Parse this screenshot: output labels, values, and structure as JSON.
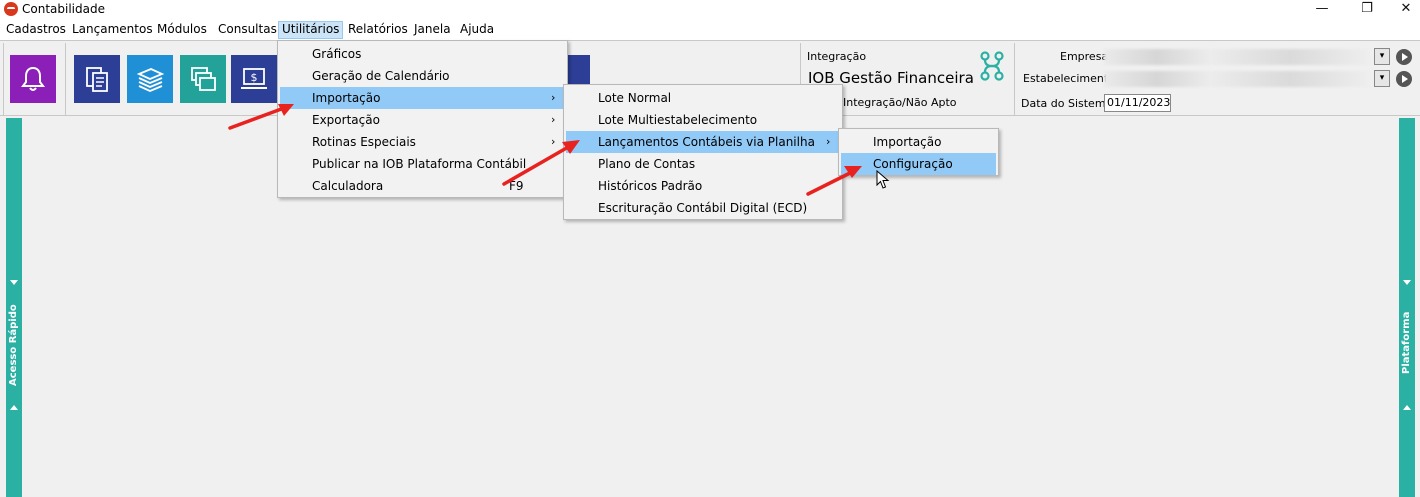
{
  "window": {
    "title": "Contabilidade",
    "minimize": "—",
    "restore": "❐",
    "close": "✕"
  },
  "menubar": [
    "Cadastros",
    "Lançamentos",
    "Módulos",
    "Consultas",
    "Utilitários",
    "Relatórios",
    "Janela",
    "Ajuda"
  ],
  "toolbar": {
    "buttons": [
      {
        "name": "notifications",
        "icon": "bell-icon",
        "color": "#8b1fb8"
      },
      {
        "name": "documents",
        "icon": "documents-icon",
        "color": "#2c3e96"
      },
      {
        "name": "money",
        "icon": "money-stack-icon",
        "color": "#1f8fd6"
      },
      {
        "name": "windows",
        "icon": "windows-icon",
        "color": "#23a29a"
      },
      {
        "name": "payment",
        "icon": "computer-dollar-icon",
        "color": "#2c3e96"
      }
    ]
  },
  "integration": {
    "label": "Integração",
    "name": "IOB Gestão Financeira",
    "status": "Integração/Não Apto",
    "icon": "integration-nodes-icon",
    "icon_color": "#2ab1a4"
  },
  "company": {
    "empresa_label": "Empresa",
    "estabelecimento_label": "Estabelecimento",
    "data_label": "Data do Sistema",
    "data_value": "01/11/2023"
  },
  "sidebars": {
    "left": "Acesso Rápido",
    "right": "Plataforma",
    "color": "#2ab1a4"
  },
  "menus": {
    "utilitarios": [
      {
        "label": "Gráficos",
        "submenu": false,
        "shortcut": ""
      },
      {
        "label": "Geração de Calendário",
        "submenu": false,
        "shortcut": ""
      },
      {
        "label": "Importação",
        "submenu": true,
        "shortcut": ""
      },
      {
        "label": "Exportação",
        "submenu": true,
        "shortcut": ""
      },
      {
        "label": "Rotinas Especiais",
        "submenu": true,
        "shortcut": ""
      },
      {
        "label": "Publicar na IOB Plataforma Contábil",
        "submenu": false,
        "shortcut": ""
      },
      {
        "label": "Calculadora",
        "submenu": false,
        "shortcut": "F9"
      }
    ],
    "importacao": [
      {
        "label": "Lote Normal",
        "submenu": false
      },
      {
        "label": "Lote Multiestabelecimento",
        "submenu": false
      },
      {
        "label": "Lançamentos Contábeis via Planilha",
        "submenu": true
      },
      {
        "label": "Plano de Contas",
        "submenu": false
      },
      {
        "label": "Históricos Padrão",
        "submenu": false
      },
      {
        "label": "Escrituração Contábil Digital (ECD)",
        "submenu": false
      }
    ],
    "planilha": [
      {
        "label": "Importação",
        "submenu": false
      },
      {
        "label": "Configuração",
        "submenu": false
      }
    ],
    "highlight_color": "#91c9f7"
  },
  "annotation": {
    "arrow_color": "#e8231f"
  }
}
